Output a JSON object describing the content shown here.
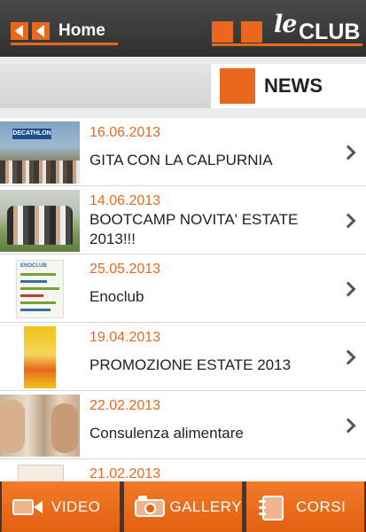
{
  "header": {
    "home_label": "Home",
    "logo_le": "le",
    "logo_club": "CLUB"
  },
  "section": {
    "title": "NEWS"
  },
  "news": [
    {
      "date": "16.06.2013",
      "title": "GITA CON LA CALPURNIA",
      "thumb_sign": "DECATHLON"
    },
    {
      "date": "14.06.2013",
      "title": "BOOTCAMP NOVITA' ESTATE 2013!!!"
    },
    {
      "date": "25.05.2013",
      "title": "Enoclub",
      "thumb_text": "ENOCLUB"
    },
    {
      "date": "19.04.2013",
      "title": "PROMOZIONE ESTATE 2013"
    },
    {
      "date": "22.02.2013",
      "title": "Consulenza alimentare"
    },
    {
      "date": "21.02.2013",
      "title": ""
    }
  ],
  "tabbar": {
    "video_label": "VIDEO",
    "gallery_label": "GALLERY",
    "corsi_label": "CORSI"
  },
  "colors": {
    "accent": "#e8691d",
    "header_bg": "#3a3a3a"
  }
}
